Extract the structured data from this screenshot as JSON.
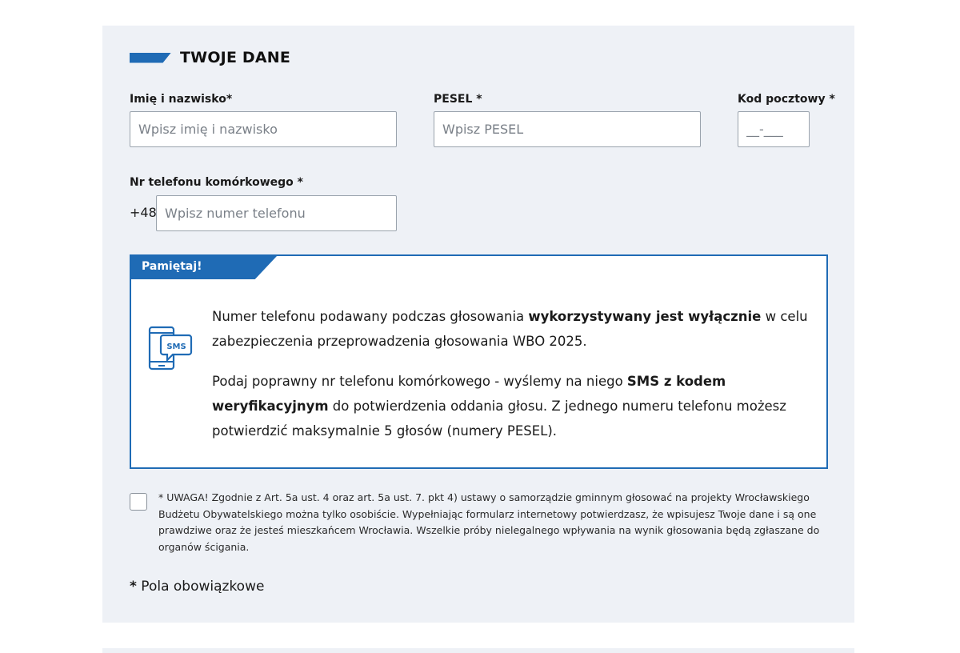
{
  "section": {
    "title": "TWOJE DANE"
  },
  "fields": {
    "name": {
      "label": "Imię i nazwisko*",
      "placeholder": "Wpisz imię i nazwisko",
      "value": ""
    },
    "pesel": {
      "label": "PESEL *",
      "placeholder": "Wpisz PESEL",
      "value": ""
    },
    "postal": {
      "label": "Kod pocztowy *",
      "placeholder": "__-___",
      "value": ""
    },
    "phone": {
      "label": "Nr telefonu komórkowego *",
      "prefix": "+48",
      "placeholder": "Wpisz numer telefonu",
      "value": ""
    }
  },
  "notice": {
    "tab_label": "Pamiętaj!",
    "icon": "sms-phone-icon",
    "icon_text": "SMS",
    "p1_a": "Numer telefonu podawany podczas głosowania ",
    "p1_b": "wykorzystywany jest wyłącznie",
    "p1_c": " w celu zabezpieczenia przeprowadzenia głosowania WBO 2025.",
    "p2_a": "Podaj poprawny nr telefonu komórkowego - wyślemy na niego ",
    "p2_b": "SMS z kodem weryfikacyjnym",
    "p2_c": " do potwierdzenia oddania głosu. Z jednego numeru telefonu możesz potwierdzić maksymalnie 5 głosów (numery PESEL)."
  },
  "consent": {
    "checked": false,
    "text": "* UWAGA! Zgodnie z Art. 5a ust. 4 oraz art. 5a ust. 7. pkt 4) ustawy o samorządzie gminnym głosować na projekty Wrocławskiego Budżetu Obywatelskiego można tylko osobiście. Wypełniając formularz internetowy potwierdzasz, że wpisujesz Twoje dane i są one prawdziwe oraz że jesteś mieszkańcem Wrocławia. Wszelkie próby nielegalnego wpływania na wynik głosowania będą zgłaszane do organów ścigania."
  },
  "required_note": {
    "star": "*",
    "text": " Pola obowiązkowe"
  },
  "colors": {
    "accent": "#1f6bb5",
    "panel_bg": "#eef1f6"
  }
}
